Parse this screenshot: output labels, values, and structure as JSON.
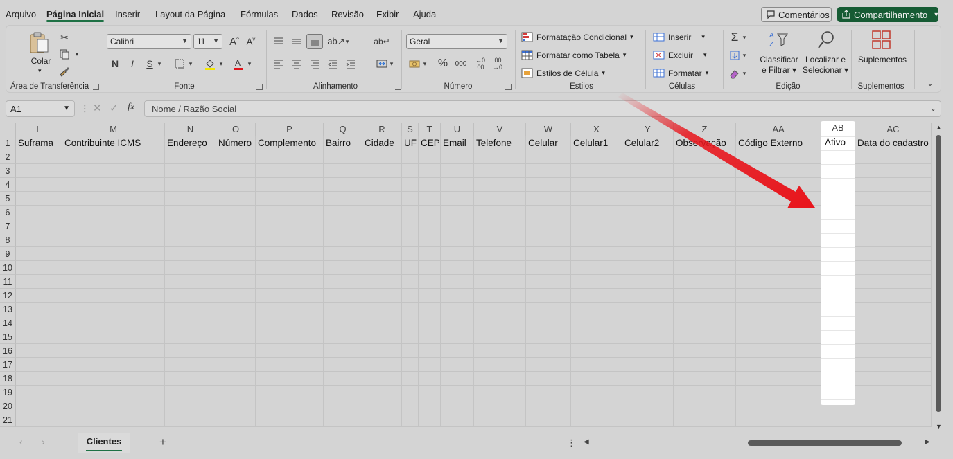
{
  "menu": {
    "tabs": [
      "Arquivo",
      "Página Inicial",
      "Inserir",
      "Layout da Página",
      "Fórmulas",
      "Dados",
      "Revisão",
      "Exibir",
      "Ajuda"
    ],
    "comments": "Comentários",
    "share": "Compartilhamento"
  },
  "ribbon": {
    "clipboard": {
      "paste": "Colar",
      "label": "Área de Transferência"
    },
    "font": {
      "name": "Calibri",
      "size": "11",
      "bold": "N",
      "italic": "I",
      "underline": "S",
      "label": "Fonte"
    },
    "alignment": {
      "label": "Alinhamento"
    },
    "number": {
      "format": "Geral",
      "label": "Número"
    },
    "styles": {
      "conditional": "Formatação Condicional",
      "table": "Formatar como Tabela",
      "cell": "Estilos de Célula",
      "label": "Estilos"
    },
    "cells": {
      "insert": "Inserir",
      "delete": "Excluir",
      "format": "Formatar",
      "label": "Células"
    },
    "editing": {
      "sort1": "Classificar",
      "sort2": "e Filtrar",
      "find1": "Localizar e",
      "find2": "Selecionar",
      "label": "Edição"
    },
    "addins": {
      "button": "Suplementos",
      "label": "Suplementos"
    }
  },
  "formula_bar": {
    "cell_ref": "A1",
    "content": "Nome / Razão Social"
  },
  "columns": [
    {
      "letter": "L",
      "header": "Suframa"
    },
    {
      "letter": "M",
      "header": "Contribuinte ICMS"
    },
    {
      "letter": "N",
      "header": "Endereço"
    },
    {
      "letter": "O",
      "header": "Número"
    },
    {
      "letter": "P",
      "header": "Complemento"
    },
    {
      "letter": "Q",
      "header": "Bairro"
    },
    {
      "letter": "R",
      "header": "Cidade"
    },
    {
      "letter": "S",
      "header": "UF"
    },
    {
      "letter": "T",
      "header": "CEP"
    },
    {
      "letter": "U",
      "header": "Email"
    },
    {
      "letter": "V",
      "header": "Telefone"
    },
    {
      "letter": "W",
      "header": "Celular"
    },
    {
      "letter": "X",
      "header": "Celular1"
    },
    {
      "letter": "Y",
      "header": "Celular2"
    },
    {
      "letter": "Z",
      "header": "Observação"
    },
    {
      "letter": "AA",
      "header": "Código Externo"
    },
    {
      "letter": "AB",
      "header": "Ativo"
    },
    {
      "letter": "AC",
      "header": "Data do cadastro"
    }
  ],
  "rows": [
    "1",
    "2",
    "3",
    "4",
    "5",
    "6",
    "7",
    "8",
    "9",
    "10",
    "11",
    "12",
    "13",
    "14",
    "15",
    "16",
    "17",
    "18",
    "19",
    "20",
    "21"
  ],
  "sheet_tab": "Clientes",
  "highlight": {
    "column": "AB",
    "header_text": "Ativo",
    "arrow_color": "#e8141b"
  }
}
